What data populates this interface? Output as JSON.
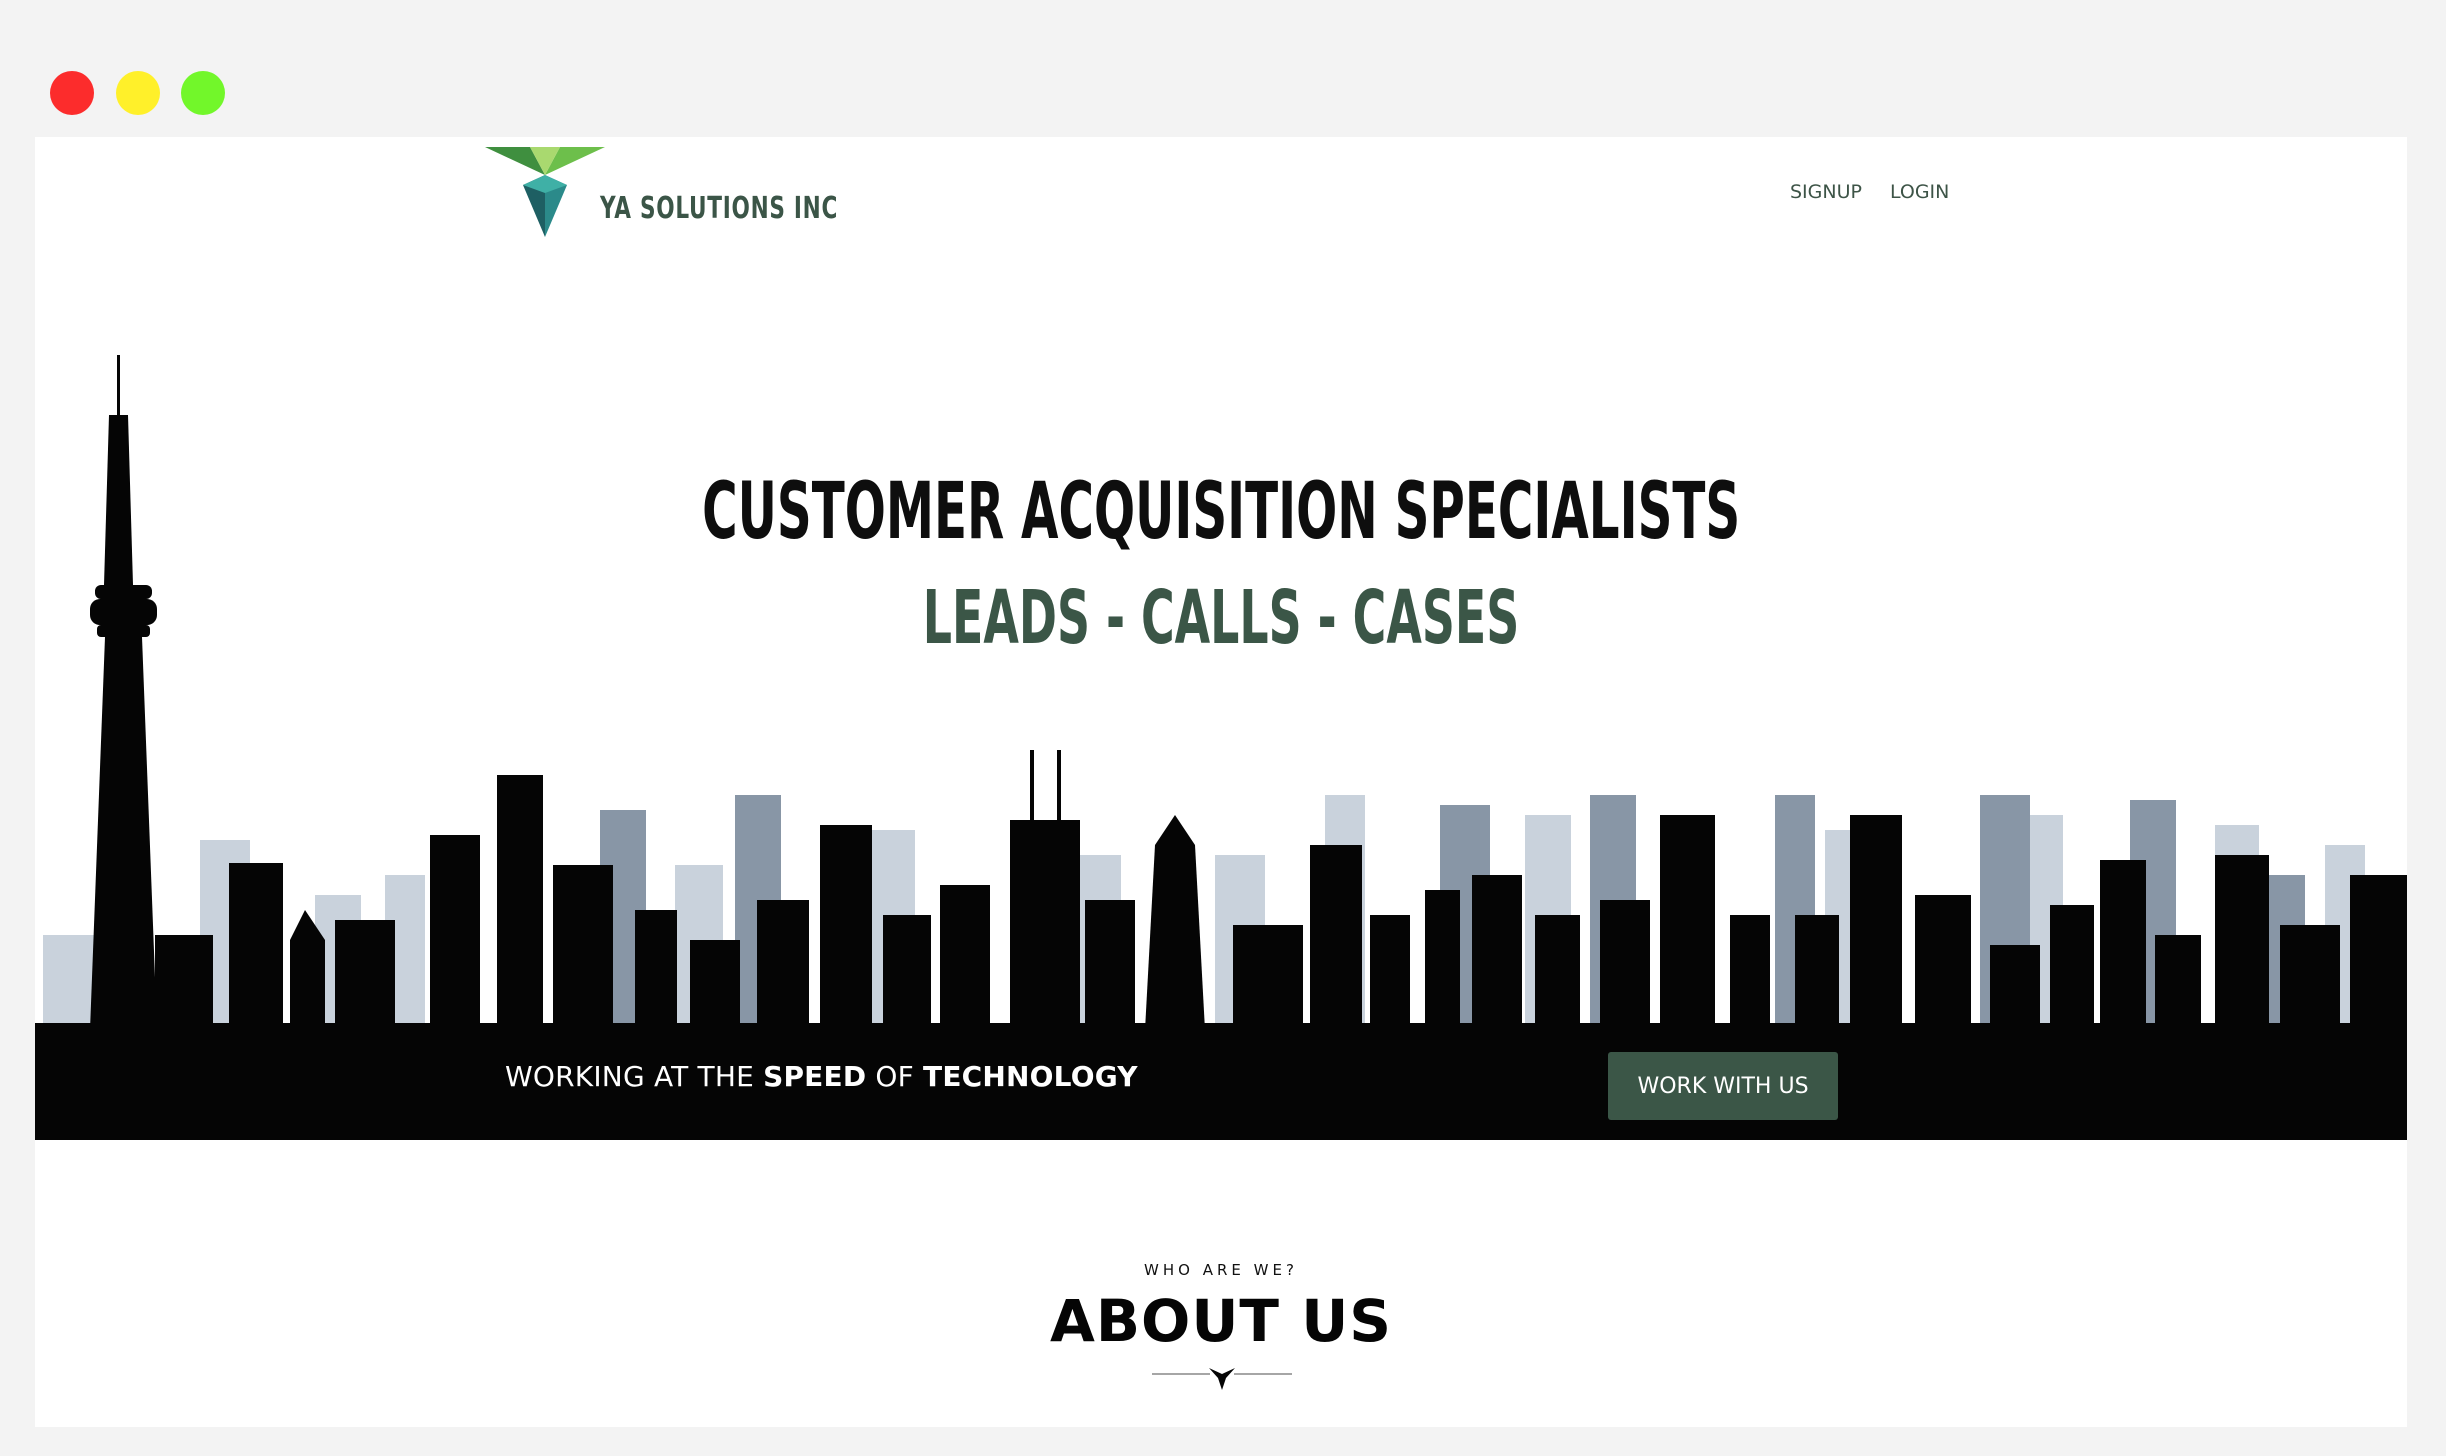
{
  "window": {
    "controls": [
      "close",
      "minimize",
      "maximize"
    ]
  },
  "header": {
    "logo_text": "YA SOLUTIONS INC",
    "nav": [
      {
        "label": "SIGNUP"
      },
      {
        "label": "LOGIN"
      }
    ]
  },
  "hero": {
    "headline": "CUSTOMER ACQUISITION SPECIALISTS",
    "subhead": "LEADS - CALLS - CASES",
    "tagline": {
      "part1": "WORKING AT THE ",
      "part2": "SPEED",
      "part3": " OF ",
      "part4": "TECHNOLOGY"
    },
    "cta_label": "WORK WITH US"
  },
  "about": {
    "kicker": "WHO ARE WE?",
    "title": "ABOUT US"
  },
  "colors": {
    "brand_green": "#3b5647",
    "logo_green": "#6dbf4b",
    "logo_teal": "#1f6f6a"
  }
}
